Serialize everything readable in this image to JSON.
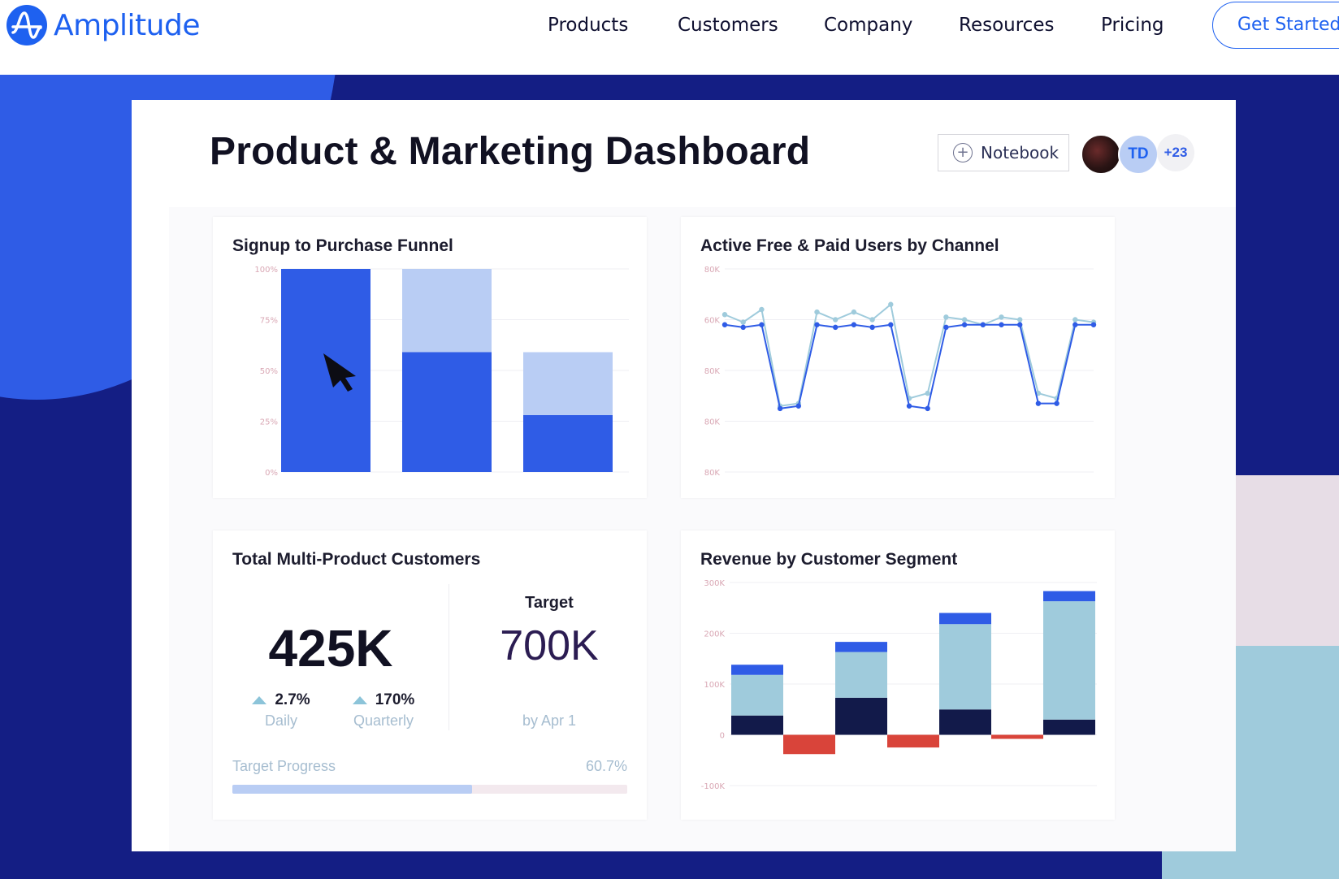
{
  "header": {
    "brand": "Amplitude",
    "nav": [
      "Products",
      "Customers",
      "Company",
      "Resources",
      "Pricing"
    ],
    "cta": "Get Started"
  },
  "dashboard": {
    "title": "Product & Marketing Dashboard",
    "notebook_label": "Notebook",
    "avatar_initials": "TD",
    "avatar_more": "+23"
  },
  "colors": {
    "accent": "#1e61f0",
    "navy": "#141e84",
    "bar_primary": "#2f5ce6",
    "bar_secondary": "#b9cdf4",
    "line_dark": "#2f5ce6",
    "line_light": "#9fcbdc",
    "segment_dark": "#121a4a",
    "segment_light": "#9fcbdc",
    "segment_top": "#2f5ce6",
    "negative": "#d9443a"
  },
  "kpi": {
    "title": "Total Multi-Product Customers",
    "value": "425K",
    "daily_value": "2.7%",
    "daily_label": "Daily",
    "quarterly_value": "170%",
    "quarterly_label": "Quarterly",
    "target_label": "Target",
    "target_value": "700K",
    "target_date": "by Apr 1",
    "progress_label": "Target Progress",
    "progress_text": "60.7%",
    "progress_fraction": 0.607
  },
  "chart_data": [
    {
      "type": "bar",
      "title": "Signup to Purchase Funnel",
      "yticks": [
        "100%",
        "75%",
        "50%",
        "25%",
        "0%"
      ],
      "ylim": [
        0,
        100
      ],
      "steps": 3,
      "series": [
        {
          "values": [
            100,
            59,
            28
          ]
        },
        {
          "values": [
            100,
            100,
            59
          ]
        }
      ],
      "grid": true
    },
    {
      "type": "line",
      "title": "Active Free & Paid Users by Channel",
      "yticks": [
        "80K",
        "60K",
        "80K",
        "80K",
        "80K"
      ],
      "ylim": [
        0,
        80
      ],
      "grid": true,
      "series": [
        {
          "values": [
            62,
            59,
            64,
            26,
            27,
            63,
            60,
            63,
            60,
            66,
            29,
            31,
            61,
            60,
            58,
            61,
            60,
            31,
            29,
            60,
            59
          ]
        },
        {
          "values": [
            58,
            57,
            58,
            25,
            26,
            58,
            57,
            58,
            57,
            58,
            26,
            25,
            57,
            58,
            58,
            58,
            58,
            27,
            27,
            58,
            58
          ]
        }
      ]
    },
    {
      "type": "bar",
      "title": "Revenue by Customer Segment",
      "yticks": [
        "300K",
        "200K",
        "100K",
        "0",
        "-100K"
      ],
      "ylim": [
        -100,
        300
      ],
      "grid": true,
      "stacked": true,
      "series": [
        {
          "values": [
            38,
            73,
            50,
            30
          ]
        },
        {
          "values": [
            80,
            90,
            168,
            233
          ]
        },
        {
          "values": [
            20,
            20,
            22,
            20
          ]
        },
        {
          "values": [
            -38,
            -25,
            -8
          ]
        }
      ]
    }
  ]
}
